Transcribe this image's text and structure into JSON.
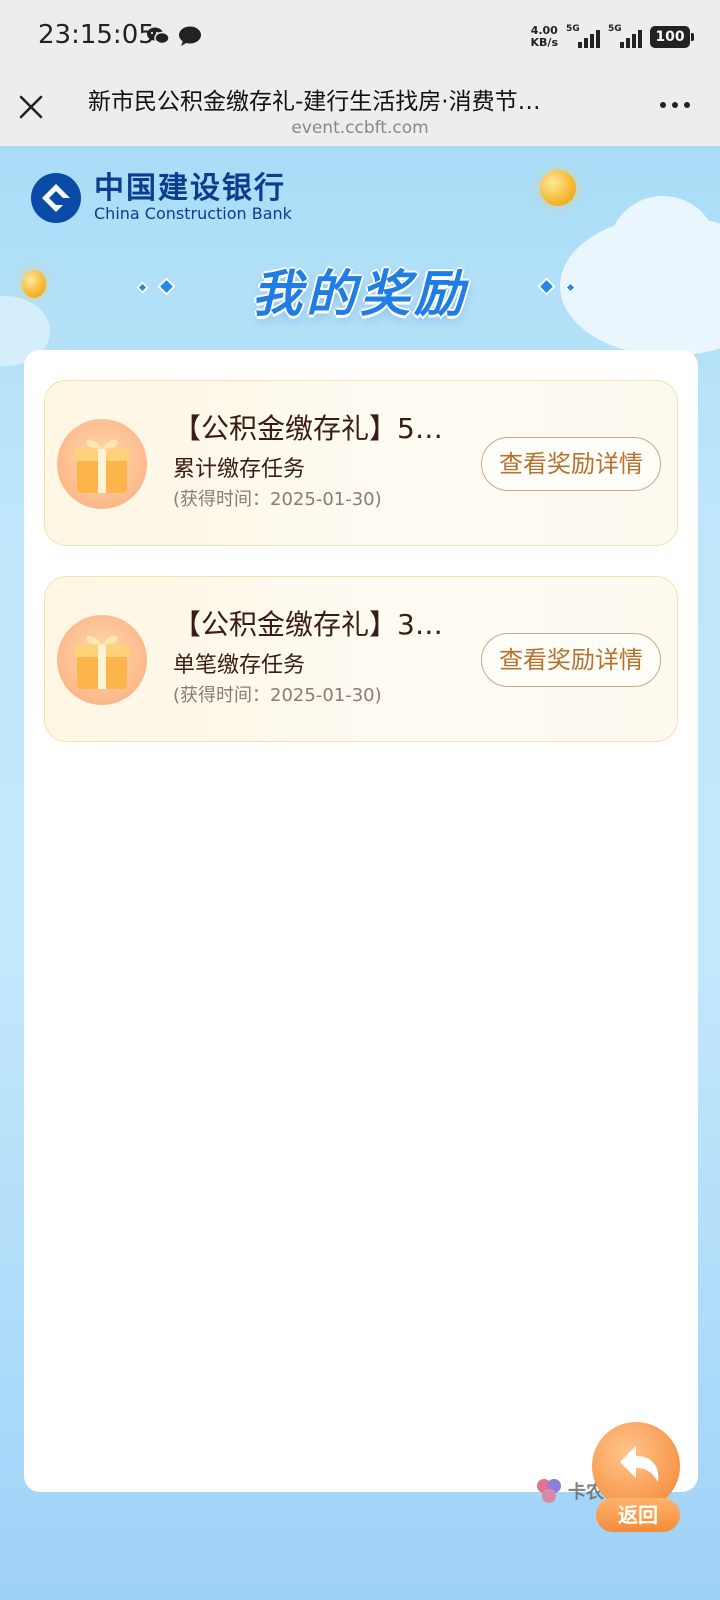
{
  "status_bar": {
    "time": "23:15:05",
    "net_speed_value": "4.00",
    "net_speed_unit": "KB/s",
    "sim1_label": "5G",
    "sim2_label": "5G",
    "battery": "100",
    "app_icons": [
      "wechat-icon",
      "message-bubble-icon"
    ]
  },
  "nav": {
    "title": "新市民公积金缴存礼-建行生活找房·消费节…",
    "url": "event.ccbft.com",
    "close_icon": "close-icon",
    "more_icon": "more-icon"
  },
  "brand": {
    "name_cn": "中国建设银行",
    "name_en": "China Construction Bank"
  },
  "page": {
    "title": "我的奖励"
  },
  "rewards": [
    {
      "name": "【公积金缴存礼】5…",
      "task": "累计缴存任务",
      "time": "(获得时间：2025-01-30)",
      "button": "查看奖励详情",
      "icon": "gift-icon"
    },
    {
      "name": "【公积金缴存礼】3…",
      "task": "单笔缴存任务",
      "time": "(获得时间：2025-01-30)",
      "button": "查看奖励详情",
      "icon": "gift-icon"
    }
  ],
  "back": {
    "label": "返回"
  },
  "watermark": {
    "text": "卡农社区"
  },
  "colors": {
    "brand_blue": "#0a3d8f",
    "title_blue": "#1e7de6",
    "button_text": "#b6722d",
    "accent_orange": "#f58b3b"
  }
}
